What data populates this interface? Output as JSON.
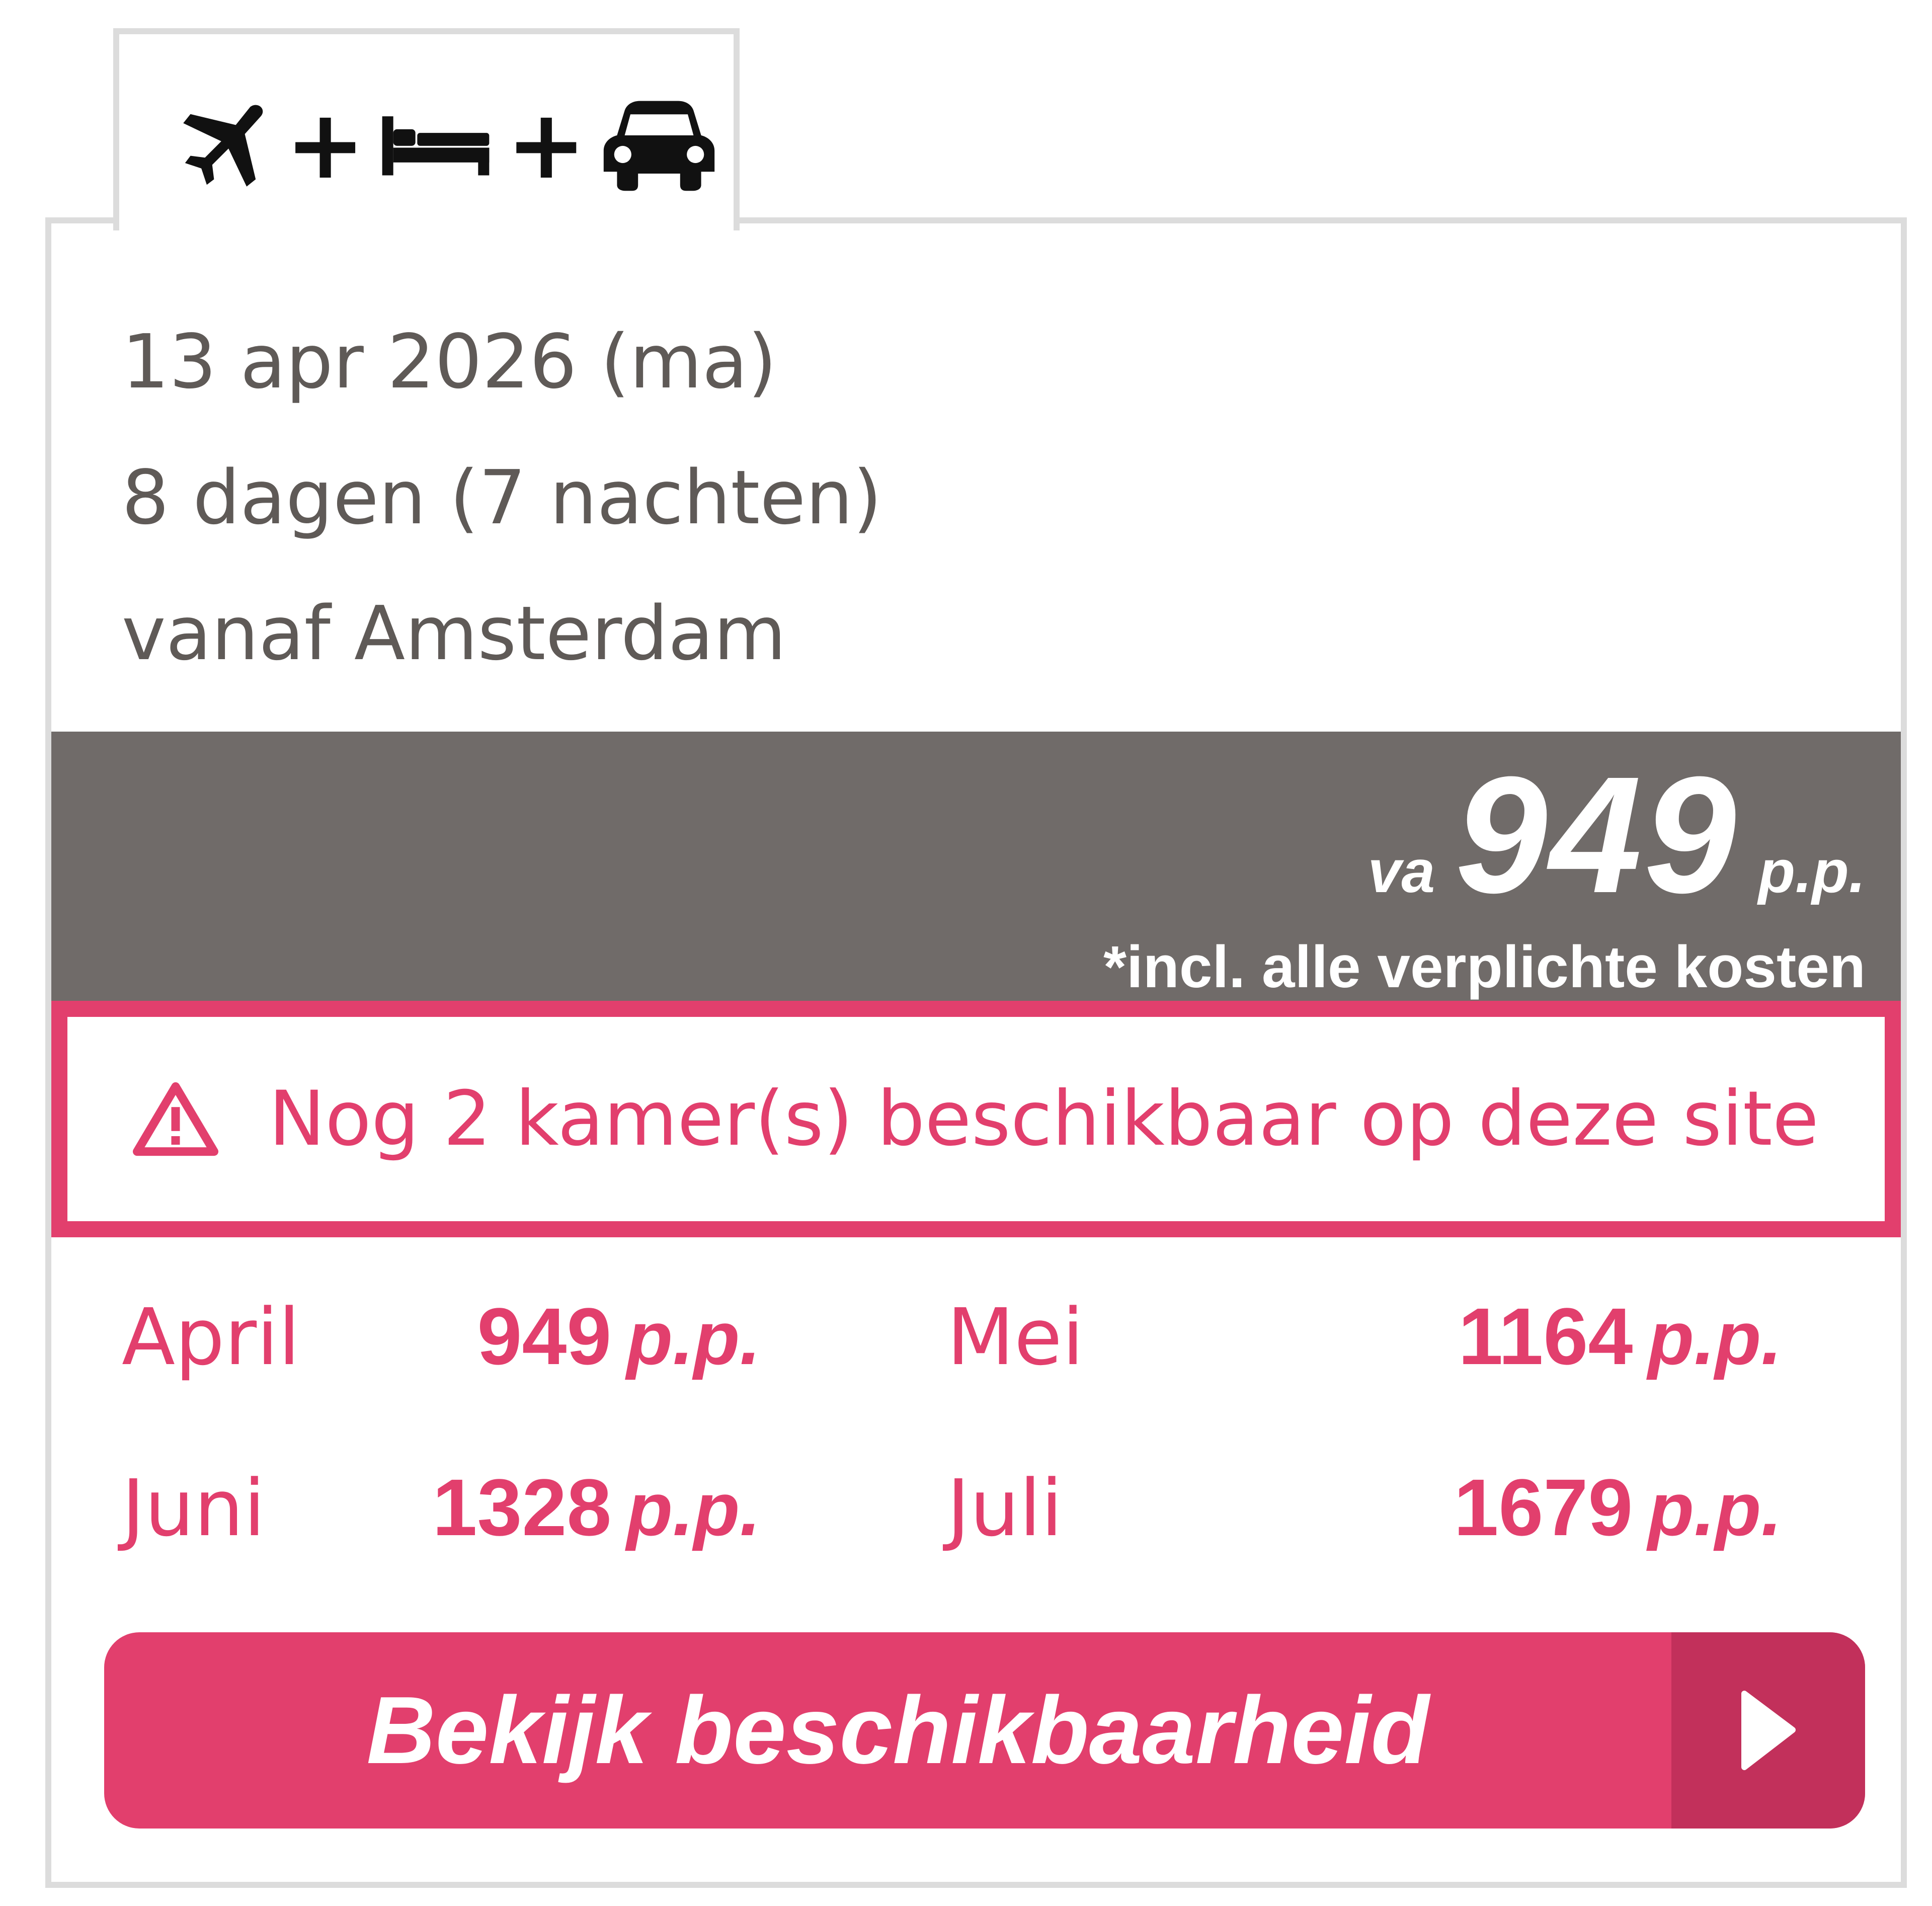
{
  "tab": {
    "icons": [
      "plane-icon",
      "bed-icon",
      "car-icon"
    ],
    "plus_1": "+",
    "plus_2": "+"
  },
  "trip": {
    "date": "13 apr 2026 (ma)",
    "duration": "8 dagen (7 nachten)",
    "departure": "vanaf Amsterdam"
  },
  "price": {
    "prefix": "va",
    "amount": "949",
    "suffix": "p.p.",
    "note": "*incl. alle verplichte kosten"
  },
  "availability": {
    "icon": "warning-icon",
    "text": "Nog 2 kamer(s) beschikbaar op deze site"
  },
  "months": [
    {
      "name": "April",
      "price": "949",
      "pp": "p.p."
    },
    {
      "name": "Mei",
      "price": "1164",
      "pp": "p.p."
    },
    {
      "name": "Juni",
      "price": "1328",
      "pp": "p.p."
    },
    {
      "name": "Juli",
      "price": "1679",
      "pp": "p.p."
    }
  ],
  "cta": {
    "label": "Bekijk beschikbaarheid",
    "icon": "play-arrow-icon"
  },
  "colors": {
    "accent": "#e23f6d",
    "accent_dark": "#c2305b",
    "price_bar": "#706b69",
    "text_grey": "#5f5a57",
    "border": "#dcdcdc"
  }
}
